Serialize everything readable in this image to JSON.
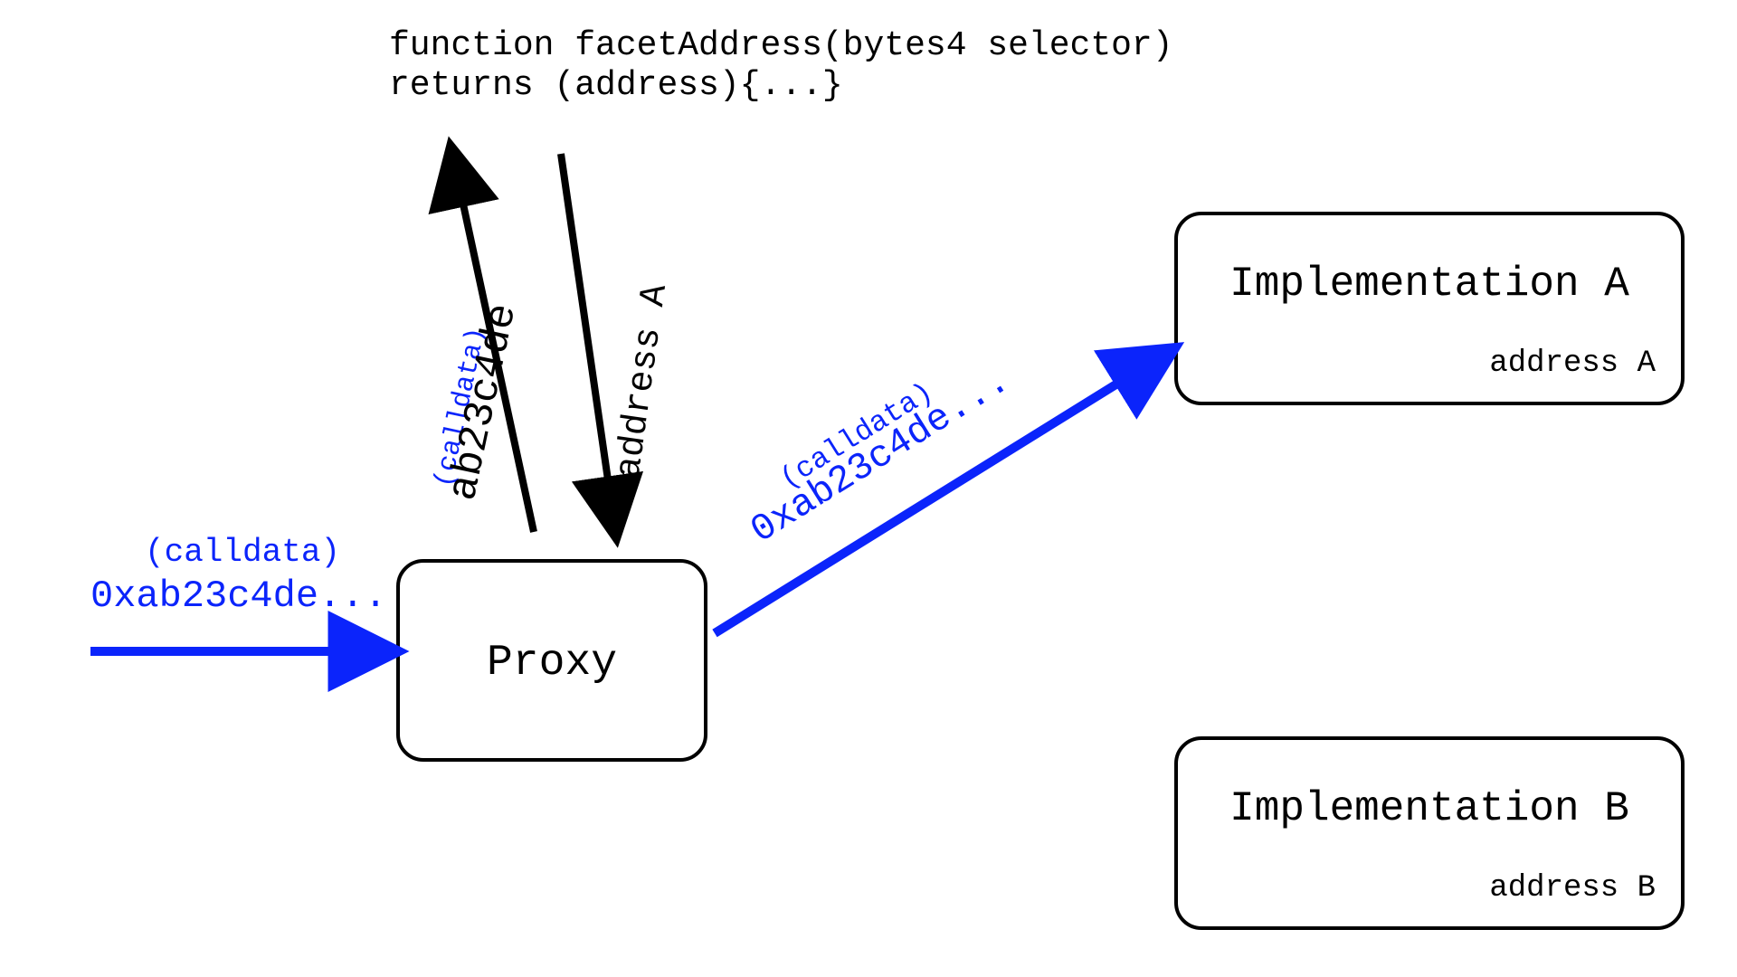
{
  "function_signature": {
    "line1": "function facetAddress(bytes4 selector)",
    "line2": "returns (address){...}"
  },
  "nodes": {
    "proxy": {
      "label": "Proxy"
    },
    "impl_a": {
      "title": "Implementation A",
      "sub": "address A"
    },
    "impl_b": {
      "title": "Implementation B",
      "sub": "address B"
    }
  },
  "edges": {
    "incoming": {
      "calldata_label": "(calldata)",
      "value": "0xab23c4de..."
    },
    "selector_up": {
      "calldata_label": "(calldata)",
      "value": "ab23c4de"
    },
    "return_down": {
      "value": "address A"
    },
    "delegate": {
      "calldata_label": "(calldata)",
      "value": "0xab23c4de..."
    }
  },
  "colors": {
    "blue": "#0b24fb",
    "black": "#000000"
  }
}
